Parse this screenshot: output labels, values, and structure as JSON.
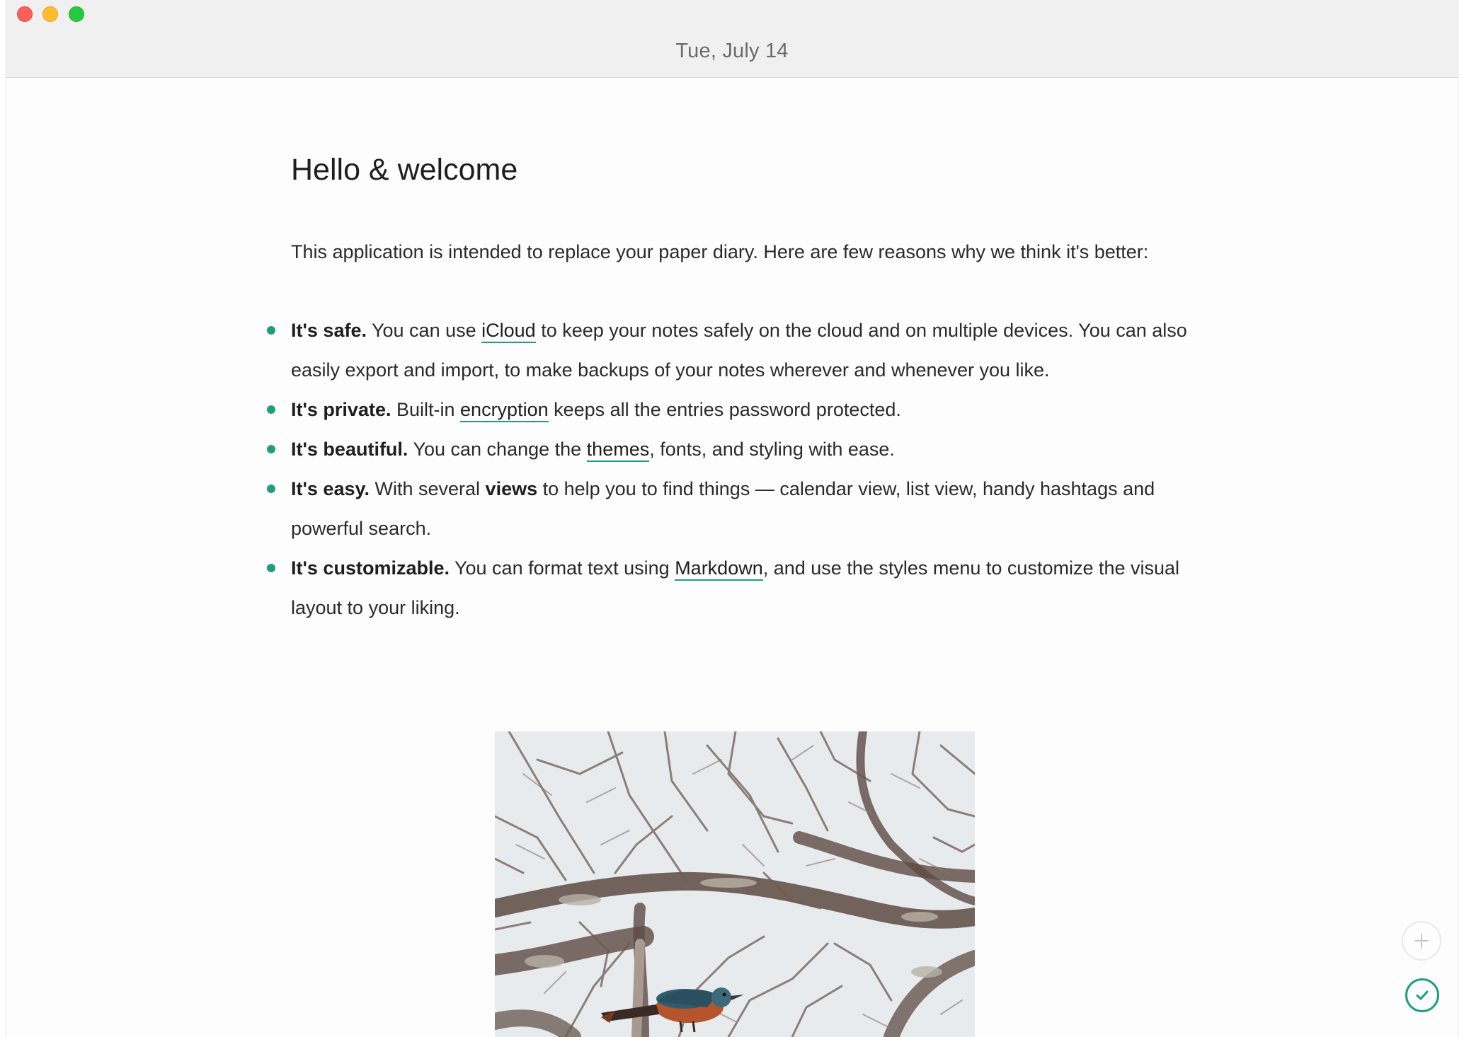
{
  "window": {
    "title": "Tue, July 14"
  },
  "document": {
    "title": "Hello & welcome",
    "intro": "This application is intended to replace your paper diary. Here are few reasons why we think it's better:",
    "features": [
      {
        "heading": "It's safe.",
        "pre": " You can use ",
        "link": "iCloud",
        "post": " to keep your notes safely on the cloud and on multiple devices. You can also easily export and import, to make backups of your notes wherever and whenever you like."
      },
      {
        "heading": "It's private.",
        "pre": " Built-in ",
        "link": "encryption",
        "post": " keeps all the entries password protected."
      },
      {
        "heading": "It's beautiful.",
        "pre": " You can change the ",
        "link": "themes",
        "post": ", fonts, and styling with ease."
      },
      {
        "heading": "It's easy.",
        "pre": " With several ",
        "strong": "views",
        "post": " to help you to find things — calendar view, list view, handy hashtags and powerful search."
      },
      {
        "heading": "It's customizable.",
        "pre": " You can format text using ",
        "link": "Markdown",
        "post": ", and use the styles menu to customize the visual layout to your liking."
      }
    ]
  },
  "image": {
    "subject": "bird-perched-in-bare-tree"
  },
  "actions": {
    "add_icon": "plus-icon",
    "done_icon": "checkmark-icon"
  },
  "colors": {
    "accent": "#1e9e7a",
    "titlebar": "#f0f0f0",
    "close": "#fe5f57",
    "minimize": "#febc2e",
    "maximize": "#28c840"
  }
}
